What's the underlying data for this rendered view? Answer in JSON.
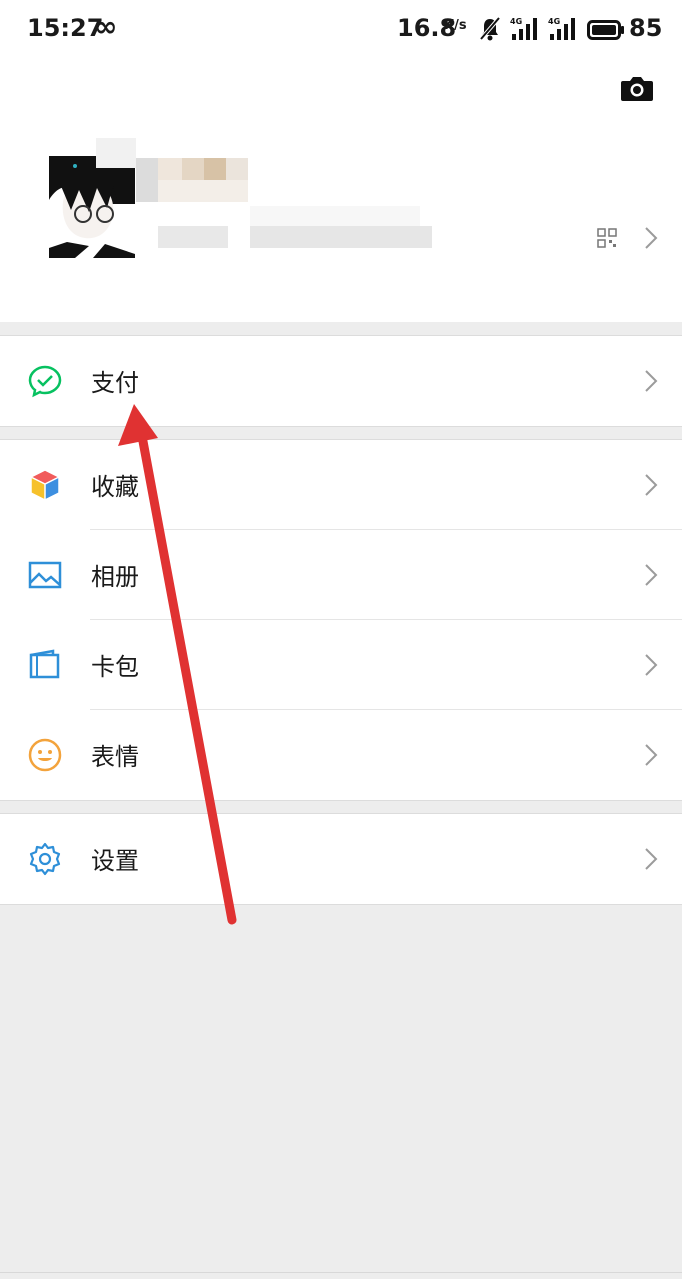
{
  "status_bar": {
    "time": "15:27",
    "infinity": "∞",
    "speed": "16.8",
    "speed_unit": "K/s",
    "battery_level": "85"
  },
  "profile": {
    "camera_icon": "camera-icon",
    "qr_icon": "qr-code-icon"
  },
  "menu": {
    "pay": {
      "label": "支付",
      "icon": "wechat-pay-icon",
      "color": "#07c160"
    },
    "favorites": {
      "label": "收藏",
      "icon": "cube-icon"
    },
    "album": {
      "label": "相册",
      "icon": "photo-icon",
      "color": "#2e8fd8"
    },
    "cards": {
      "label": "卡包",
      "icon": "card-wallet-icon",
      "color": "#2e8fd8"
    },
    "stickers": {
      "label": "表情",
      "icon": "smiley-icon",
      "color": "#f3a33c"
    },
    "settings": {
      "label": "设置",
      "icon": "gear-icon",
      "color": "#2e8fd8"
    }
  },
  "annotation": {
    "arrow_color": "#e03232"
  }
}
